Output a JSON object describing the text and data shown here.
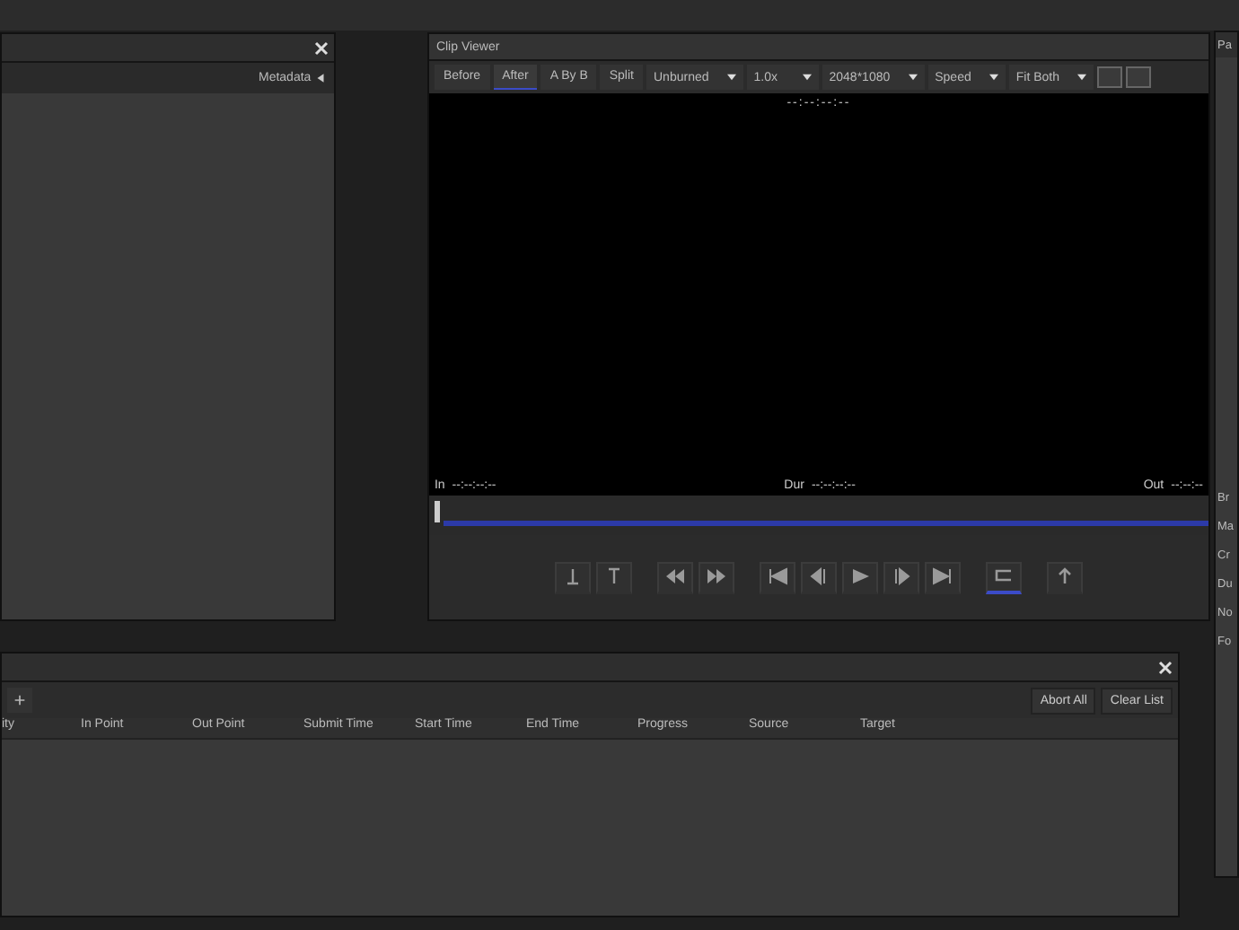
{
  "left_panel": {
    "metadata_label": "Metadata"
  },
  "clip_viewer": {
    "title": "Clip Viewer",
    "toolbar": [
      {
        "kind": "tab",
        "label": "Before",
        "selected": false
      },
      {
        "kind": "tab",
        "label": "After",
        "selected": true
      },
      {
        "kind": "tab",
        "label": "A By B",
        "selected": false
      },
      {
        "kind": "tab",
        "label": "Split",
        "selected": false
      },
      {
        "kind": "dropdown",
        "label": "Unburned"
      },
      {
        "kind": "dropdown",
        "label": "1.0x"
      },
      {
        "kind": "dropdown",
        "label": "2048*1080"
      },
      {
        "kind": "dropdown",
        "label": "Speed"
      },
      {
        "kind": "dropdown",
        "label": "Fit Both"
      }
    ],
    "timecode": "--:--:--:--",
    "in_label": "In",
    "in_time": "--:--:--:--",
    "dur_label": "Dur",
    "dur_time": "--:--:--:--",
    "out_label": "Out",
    "out_time": "--:--:--",
    "transport": [
      {
        "kind": "mark-in",
        "selected": false
      },
      {
        "kind": "mark-out",
        "selected": false
      },
      {
        "kind": "prev-mark",
        "selected": false
      },
      {
        "kind": "next-mark",
        "selected": false
      },
      {
        "kind": "start",
        "selected": false
      },
      {
        "kind": "step-back",
        "selected": false
      },
      {
        "kind": "play",
        "selected": false
      },
      {
        "kind": "step-forward",
        "selected": false
      },
      {
        "kind": "end",
        "selected": false
      },
      {
        "kind": "loop",
        "selected": true
      },
      {
        "kind": "export",
        "selected": false
      }
    ]
  },
  "right_panel": {
    "title": "Pa",
    "items": [
      "Br",
      "Ma",
      "Cr",
      "Du",
      "No",
      "Fo"
    ]
  },
  "render_queue": {
    "buttons": [
      "Abort All",
      "Clear List"
    ],
    "columns": [
      "ity",
      "In Point",
      "Out Point",
      "Submit Time",
      "Start Time",
      "End Time",
      "Progress",
      "Source",
      "Target"
    ]
  }
}
